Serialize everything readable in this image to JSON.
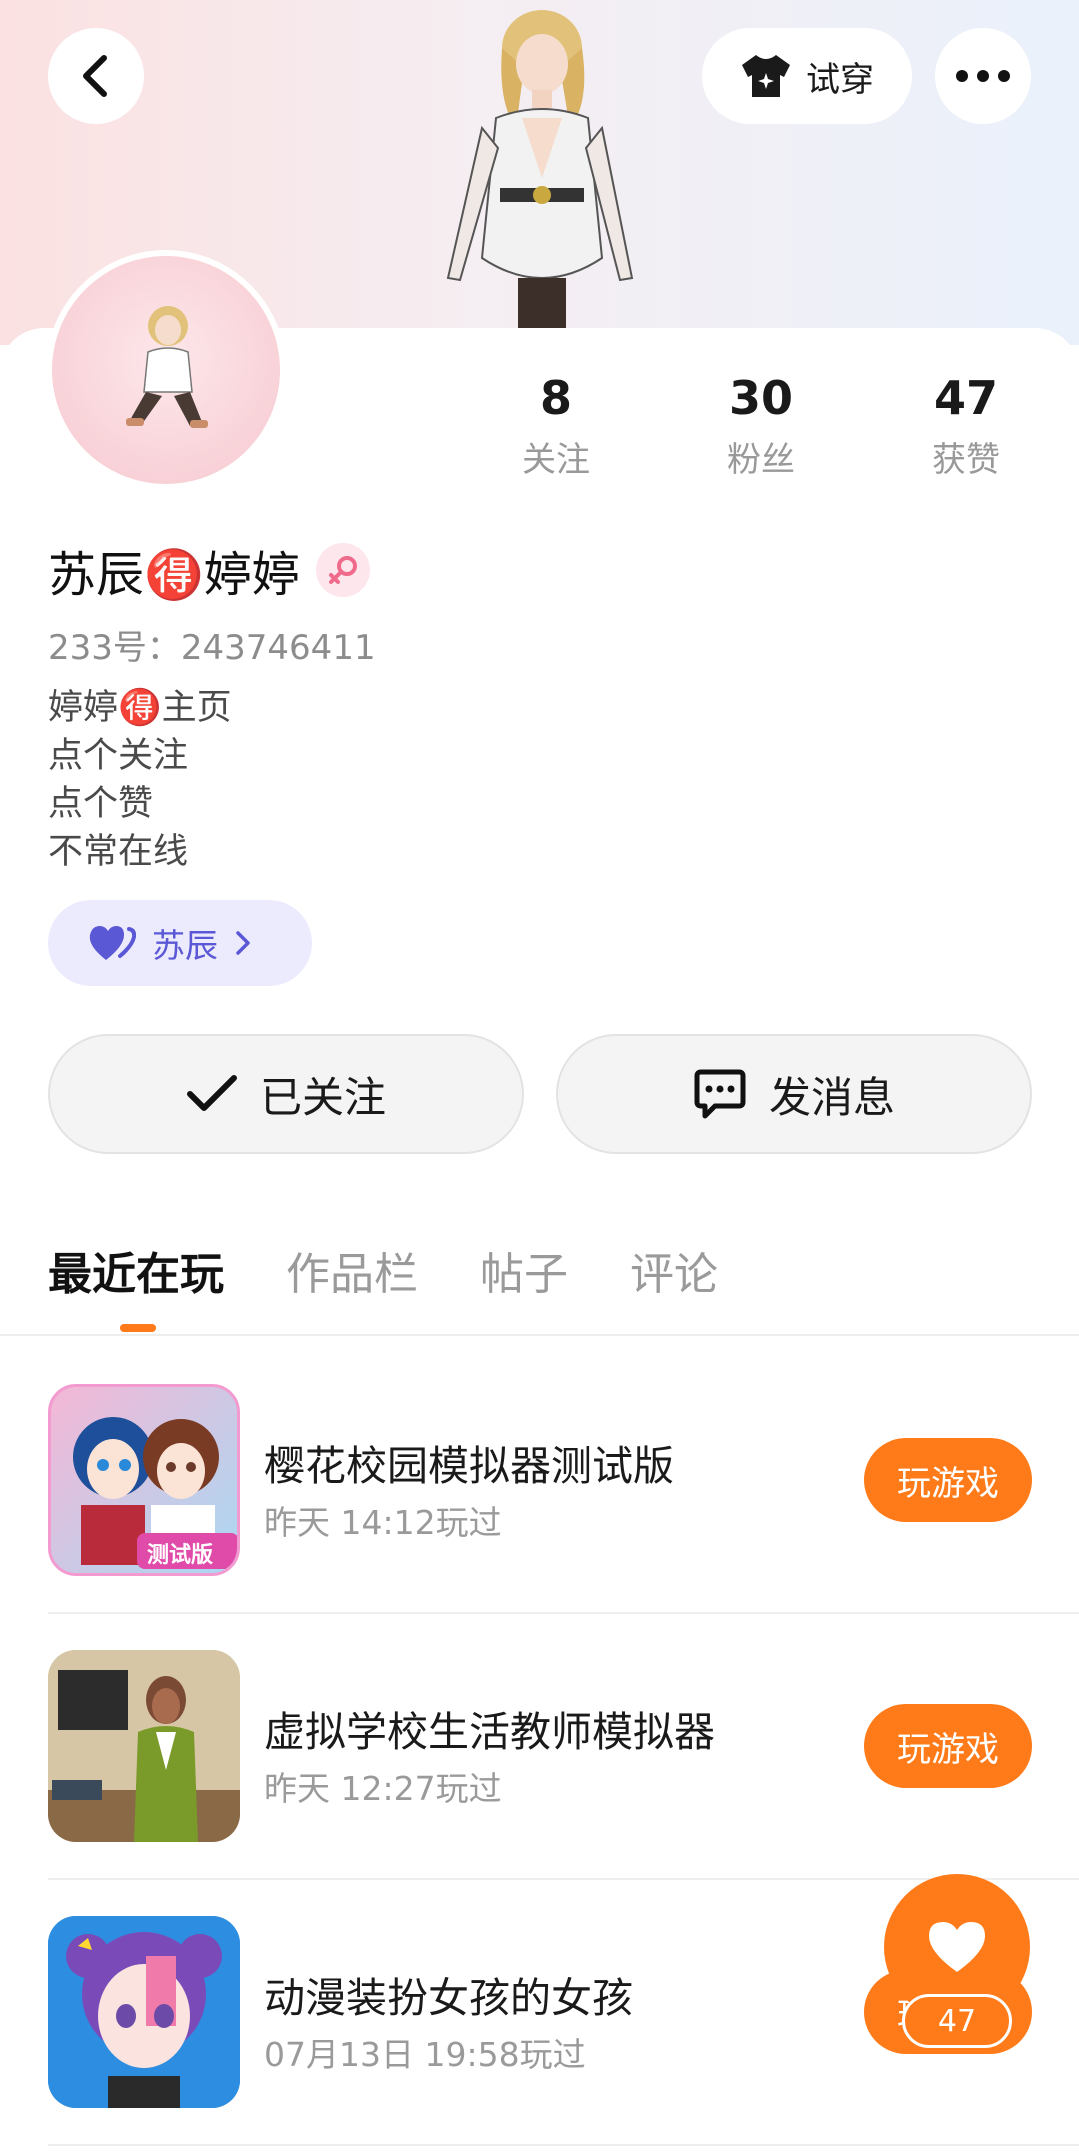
{
  "header": {
    "try_on_label": "试穿",
    "back_icon": "chevron-left-icon",
    "more_icon": "more-dots-icon",
    "try_on_icon": "shirt-icon"
  },
  "profile": {
    "name": "苏辰🉐婷婷",
    "uid_label": "233号：243746411",
    "bio": [
      "婷婷🉐主页",
      "点个关注",
      "点个赞",
      "不常在线"
    ],
    "gender": "female",
    "relation_label": "苏辰"
  },
  "stats": [
    {
      "value": "8",
      "label": "关注"
    },
    {
      "value": "30",
      "label": "粉丝"
    },
    {
      "value": "47",
      "label": "获赞"
    }
  ],
  "actions": {
    "follow_label": "已关注",
    "message_label": "发消息"
  },
  "tabs": [
    "最近在玩",
    "作品栏",
    "帖子",
    "评论"
  ],
  "games": [
    {
      "title": "樱花校园模拟器测试版",
      "time": "昨天 14:12玩过",
      "button": "玩游戏",
      "badge": "测试版"
    },
    {
      "title": "虚拟学校生活教师模拟器",
      "time": "昨天 12:27玩过",
      "button": "玩游戏"
    },
    {
      "title": "动漫装扮女孩的女孩",
      "time": "07月13日 19:58玩过",
      "button": "玩游戏"
    }
  ],
  "like_fab": {
    "count": "47"
  },
  "colors": {
    "accent": "#ff7a18",
    "relation_bg": "#ecebfd",
    "relation_text": "#5b58d6"
  }
}
